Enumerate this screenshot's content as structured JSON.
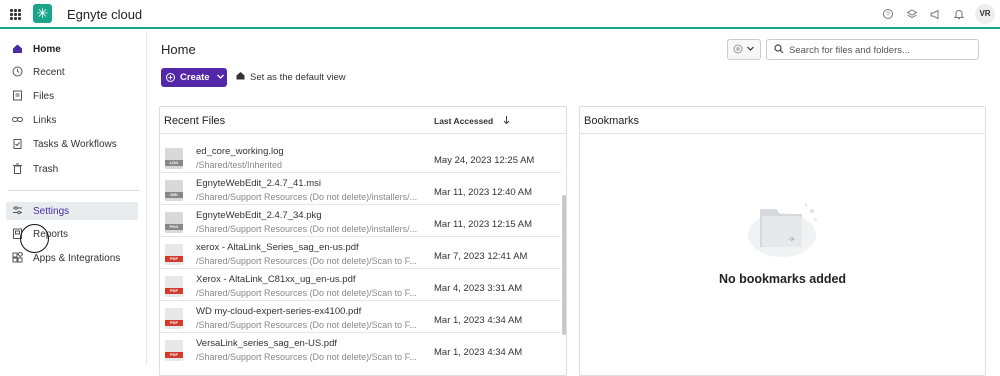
{
  "topbar": {
    "app_title": "Egnyte cloud",
    "logo_glyph": "✳",
    "icons": [
      "help-icon",
      "layers-icon",
      "megaphone-icon",
      "bell-icon"
    ],
    "avatar_initials": "VR",
    "accent_color": "#1aa58b"
  },
  "sidebar": {
    "items": [
      {
        "label": "Home",
        "icon": "home-icon"
      },
      {
        "label": "Recent",
        "icon": "clock-icon"
      },
      {
        "label": "Files",
        "icon": "file-icon"
      },
      {
        "label": "Links",
        "icon": "link-icon"
      },
      {
        "label": "Tasks & Workflows",
        "icon": "clipboard-icon"
      },
      {
        "label": "Trash",
        "icon": "trash-icon"
      },
      {
        "label": "Settings",
        "icon": "sliders-icon"
      },
      {
        "label": "Reports",
        "icon": "report-icon"
      },
      {
        "label": "Apps & Integrations",
        "icon": "apps-icon"
      }
    ]
  },
  "main": {
    "title": "Home",
    "search_placeholder": "Search for files and folders...",
    "create_label": "Create",
    "default_view_label": "Set as the default view",
    "brand_color": "#5327a8"
  },
  "recent_files": {
    "title": "Recent Files",
    "column_header": "Last Accessed",
    "rows": [
      {
        "name": "ed_core_working.log",
        "path": "/Shared/test/Inherited",
        "date": "May 24, 2023 12:25 AM",
        "type": "LOG"
      },
      {
        "name": "EgnyteWebEdit_2.4.7_41.msi",
        "path": "/Shared/Support Resources (Do not delete)/installers/...",
        "date": "Mar 11, 2023 12:40 AM",
        "type": "MSI"
      },
      {
        "name": "EgnyteWebEdit_2.4.7_34.pkg",
        "path": "/Shared/Support Resources (Do not delete)/installers/...",
        "date": "Mar 11, 2023 12:15 AM",
        "type": "PKG"
      },
      {
        "name": "xerox - AltaLink_Series_sag_en-us.pdf",
        "path": "/Shared/Support Resources (Do not delete)/Scan to F...",
        "date": "Mar 7, 2023 12:41 AM",
        "type": "PDF"
      },
      {
        "name": "Xerox - AltaLink_C81xx_ug_en-us.pdf",
        "path": "/Shared/Support Resources (Do not delete)/Scan to F...",
        "date": "Mar 4, 2023 3:31 AM",
        "type": "PDF"
      },
      {
        "name": "WD my-cloud-expert-series-ex4100.pdf",
        "path": "/Shared/Support Resources (Do not delete)/Scan to F...",
        "date": "Mar 1, 2023 4:34 AM",
        "type": "PDF"
      },
      {
        "name": "VersaLink_series_sag_en-US.pdf",
        "path": "/Shared/Support Resources (Do not delete)/Scan to F...",
        "date": "Mar 1, 2023 4:34 AM",
        "type": "PDF"
      }
    ]
  },
  "bookmarks": {
    "title": "Bookmarks",
    "empty_text": "No bookmarks added"
  }
}
